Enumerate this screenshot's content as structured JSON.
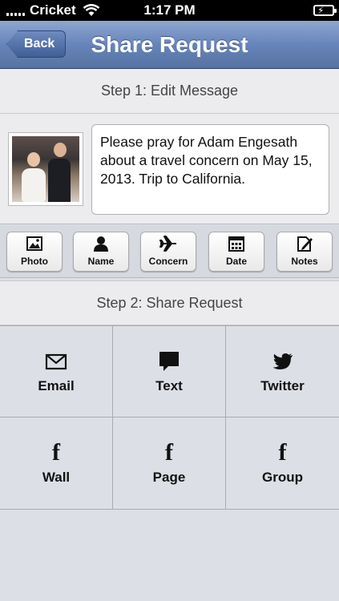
{
  "status_bar": {
    "carrier": "Cricket",
    "time": "1:17 PM"
  },
  "nav": {
    "back_label": "Back",
    "title": "Share Request"
  },
  "step1": {
    "title": "Step 1: Edit Message"
  },
  "message": {
    "text": "Please pray for Adam Engesath about a travel concern on May 15, 2013. Trip to California."
  },
  "toolbar": {
    "items": [
      {
        "label": "Photo",
        "icon": "photo-icon"
      },
      {
        "label": "Name",
        "icon": "person-icon"
      },
      {
        "label": "Concern",
        "icon": "airplane-icon"
      },
      {
        "label": "Date",
        "icon": "calendar-icon"
      },
      {
        "label": "Notes",
        "icon": "notes-icon"
      }
    ]
  },
  "step2": {
    "title": "Step 2: Share Request"
  },
  "share": {
    "items": [
      {
        "label": "Email",
        "icon": "envelope-icon"
      },
      {
        "label": "Text",
        "icon": "speech-bubble-icon"
      },
      {
        "label": "Twitter",
        "icon": "twitter-bird-icon"
      },
      {
        "label": "Wall",
        "icon": "facebook-icon",
        "glyph": "f"
      },
      {
        "label": "Page",
        "icon": "facebook-icon",
        "glyph": "f"
      },
      {
        "label": "Group",
        "icon": "facebook-icon",
        "glyph": "f"
      }
    ]
  }
}
